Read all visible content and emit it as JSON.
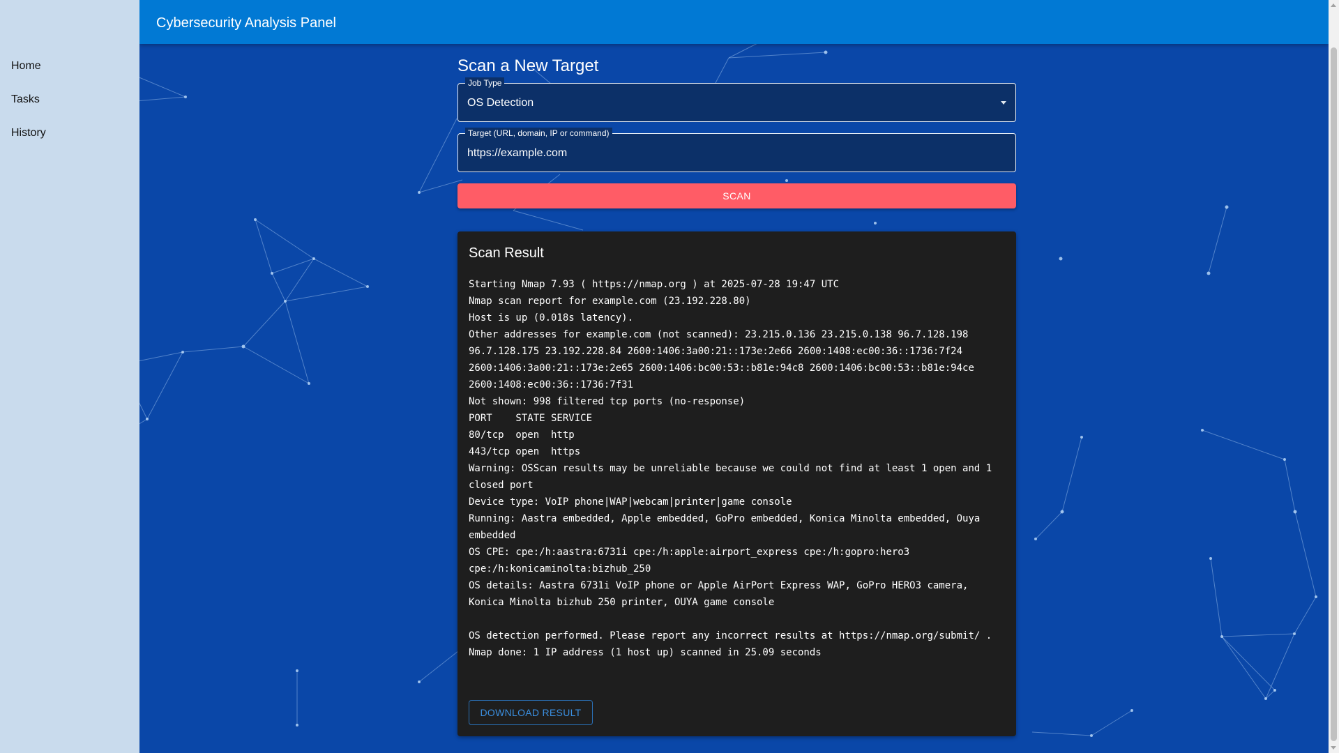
{
  "app": {
    "title": "Cybersecurity Analysis Panel"
  },
  "sidebar": {
    "items": [
      {
        "label": "Home"
      },
      {
        "label": "Tasks"
      },
      {
        "label": "History"
      }
    ]
  },
  "scan_form": {
    "heading": "Scan a New Target",
    "job_type": {
      "label": "Job Type",
      "selected": "OS Detection"
    },
    "target": {
      "label": "Target (URL, domain, IP or command)",
      "value": "https://example.com"
    },
    "scan_label": "SCAN"
  },
  "result": {
    "title": "Scan Result",
    "output": "Starting Nmap 7.93 ( https://nmap.org ) at 2025-07-28 19:47 UTC\nNmap scan report for example.com (23.192.228.80)\nHost is up (0.018s latency).\nOther addresses for example.com (not scanned): 23.215.0.136 23.215.0.138 96.7.128.198 96.7.128.175 23.192.228.84 2600:1406:3a00:21::173e:2e66 2600:1408:ec00:36::1736:7f24 2600:1406:3a00:21::173e:2e65 2600:1406:bc00:53::b81e:94c8 2600:1406:bc00:53::b81e:94ce 2600:1408:ec00:36::1736:7f31\nNot shown: 998 filtered tcp ports (no-response)\nPORT    STATE SERVICE\n80/tcp  open  http\n443/tcp open  https\nWarning: OSScan results may be unreliable because we could not find at least 1 open and 1 closed port\nDevice type: VoIP phone|WAP|webcam|printer|game console\nRunning: Aastra embedded, Apple embedded, GoPro embedded, Konica Minolta embedded, Ouya embedded\nOS CPE: cpe:/h:aastra:6731i cpe:/h:apple:airport_express cpe:/h:gopro:hero3 cpe:/h:konicaminolta:bizhub_250\nOS details: Aastra 6731i VoIP phone or Apple AirPort Express WAP, GoPro HERO3 camera, Konica Minolta bizhub 250 printer, OUYA game console\n\nOS detection performed. Please report any incorrect results at https://nmap.org/submit/ .\nNmap done: 1 IP address (1 host up) scanned in 25.09 seconds",
    "download_label": "DOWNLOAD RESULT"
  },
  "colors": {
    "background": "#0a47a8",
    "appbar": "#0179d4",
    "sidebar": "#c9dbed",
    "scan_button": "#ff5c66",
    "result_panel": "#1e1e1e"
  }
}
